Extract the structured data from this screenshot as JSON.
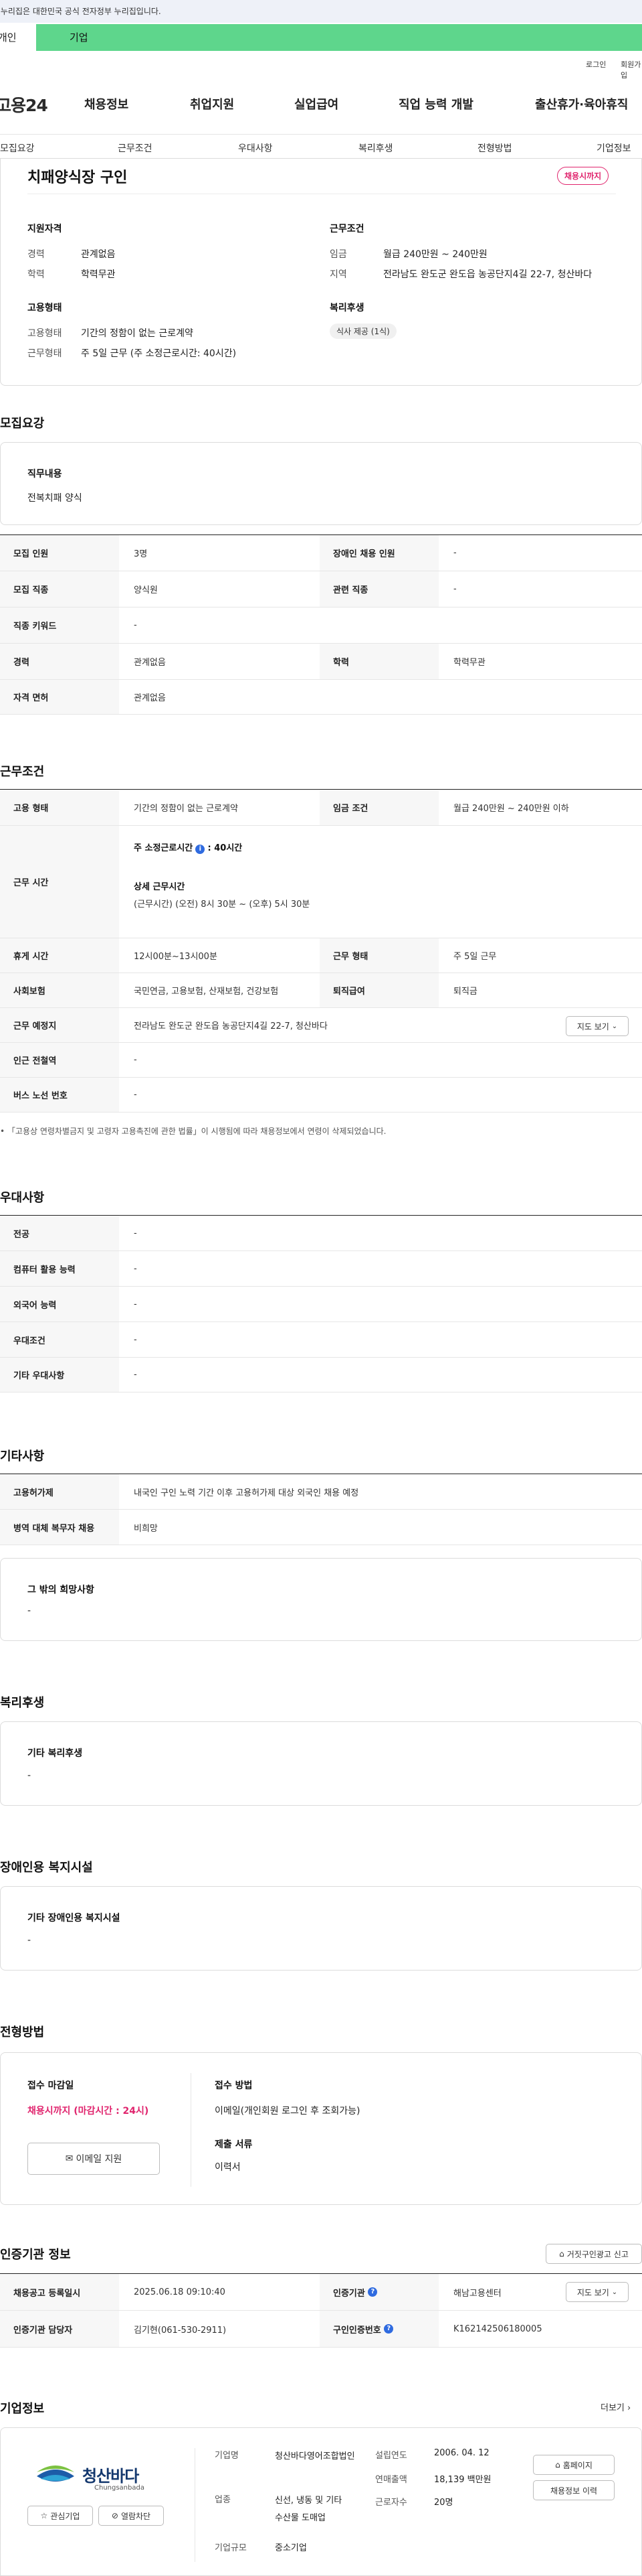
{
  "gov_bar": "이 누리집은 대한민국 공식 전자정부 누리집입니다.",
  "top_tabs": {
    "personal": "개인",
    "company": "기업"
  },
  "util": {
    "login": "로그인",
    "signup": "회원가입"
  },
  "logo": "고용24",
  "gnb": [
    "채용정보",
    "취업지원",
    "실업급여",
    "직업 능력 개발",
    "출산휴가·육아휴직"
  ],
  "subnav": [
    "모집요강",
    "근무조건",
    "우대사항",
    "복리후생",
    "전형방법",
    "기업정보"
  ],
  "summary": {
    "title": "치패양식장 구인",
    "status": "채용시까지",
    "qual_title": "지원자격",
    "career_label": "경력",
    "career_value": "관계없음",
    "edu_label": "학력",
    "edu_value": "학력무관",
    "emp_title": "고용형태",
    "emp_label": "고용형태",
    "emp_value": "기간의 정함이 없는 근로계약",
    "work_form_label": "근무형태",
    "work_form_value": "주 5일 근무 (주 소정근로시간: 40시간)",
    "cond_title": "근무조건",
    "wage_label": "임금",
    "wage_value": "월급 240만원 ~ 240만원",
    "region_label": "지역",
    "region_value": "전라남도 완도군 완도읍 농공단지4길 22-7, 청산바다",
    "welfare_title": "복리후생",
    "welfare_pill": "식사 제공 (1식)"
  },
  "recruit": {
    "heading": "모집요강",
    "duty_title": "직무내용",
    "duty_value": "전복치패 양식",
    "rows": [
      {
        "l1": "모집 인원",
        "v1": "3명",
        "l2": "장애인 채용 인원",
        "v2": "-"
      },
      {
        "l1": "모집 직종",
        "v1": "양식원",
        "l2": "관련 직종",
        "v2": "-"
      },
      {
        "l1": "직종 키워드",
        "v1": "-"
      },
      {
        "l1": "경력",
        "v1": "관계없음",
        "l2": "학력",
        "v2": "학력무관"
      },
      {
        "l1": "자격 면허",
        "v1": "관계없음"
      }
    ]
  },
  "workcond": {
    "heading": "근무조건",
    "emp_type_label": "고용 형태",
    "emp_type_value": "기간의 정함이 없는 근로계약",
    "wage_label": "임금 조건",
    "wage_value": "월급 240만원 ~ 240만원 이하",
    "hours_label": "근무 시간",
    "hours_week": "주 소정근로시간",
    "hours_week_value": ": 40시간",
    "hours_detail_title": "상세 근무시간",
    "hours_detail_value": "(근무시간) (오전) 8시 30분 ~ (오후) 5시 30분",
    "break_label": "휴게 시간",
    "break_value": "12시00분~13시00분",
    "form_label": "근무 형태",
    "form_value": "주 5일 근무",
    "insurance_label": "사회보험",
    "insurance_value": "국민연금, 고용보험, 산재보험, 건강보험",
    "severance_label": "퇴직급여",
    "severance_value": "퇴직금",
    "location_label": "근무 예정지",
    "location_value": "전라남도 완도군 완도읍 농공단지4길 22-7, 청산바다",
    "map_btn": "지도 보기",
    "subway_label": "인근 전철역",
    "subway_value": "-",
    "bus_label": "버스 노선 번호",
    "bus_value": "-",
    "note": "「고용상 연령차별금지 및 고령자 고용촉진에 관한 법률」이 시행됨에 따라 채용정보에서 연령이 삭제되었습니다."
  },
  "pref": {
    "heading": "우대사항",
    "rows": [
      {
        "l": "전공",
        "v": "-"
      },
      {
        "l": "컴퓨터 활용 능력",
        "v": "-"
      },
      {
        "l": "외국어 능력",
        "v": "-"
      },
      {
        "l": "우대조건",
        "v": "-"
      },
      {
        "l": "기타 우대사항",
        "v": "-"
      }
    ]
  },
  "etc": {
    "heading": "기타사항",
    "rows": [
      {
        "l": "고용허가제",
        "v": "내국인 구인 노력 기간 이후 고용허가제 대상 외국인 채용 예정"
      },
      {
        "l": "병역 대체 복무자 채용",
        "v": "비희망"
      }
    ],
    "wish_title": "그 밖의 희망사항",
    "wish_value": "-"
  },
  "welfare": {
    "heading": "복리후생",
    "card_title": "기타 복리후생",
    "card_value": "-"
  },
  "disabled": {
    "heading": "장애인용 복지시설",
    "card_title": "기타 장애인용 복지시설",
    "card_value": "-"
  },
  "selection": {
    "heading": "전형방법",
    "deadline_title": "접수 마감일",
    "deadline_value": "채용시까지 (마감시간 : 24시)",
    "email_btn": "이메일 지원",
    "method_title": "접수 방법",
    "method_value": "이메일(개인회원 로그인 후 조회가능)",
    "docs_title": "제출 서류",
    "docs_value": "이력서"
  },
  "cert": {
    "heading": "인증기관 정보",
    "report_btn": "거짓구인광고 신고",
    "reg_label": "채용공고 등록일시",
    "reg_value": "2025.06.18 09:10:40",
    "org_label": "인증기관",
    "org_value": "해남고용센터",
    "map_btn": "지도 보기",
    "mgr_label": "인증기관 담당자",
    "mgr_value": "김기현(061-530-2911)",
    "no_label": "구인인증번호",
    "no_value": "K162142506180005"
  },
  "company": {
    "heading": "기업정보",
    "more": "더보기",
    "logo_kr": "청산바다",
    "logo_en": "Chungsanbada",
    "fav_btn": "관심기업",
    "block_btn": "열람차단",
    "name_label": "기업명",
    "name_value": "청산바다영어조합법인",
    "ind_label": "업종",
    "ind_value": "신선, 냉동 및 기타 수산물 도매업",
    "size_label": "기업규모",
    "size_value": "중소기업",
    "est_label": "설립연도",
    "est_value": "2006. 04. 12",
    "sales_label": "연매출액",
    "sales_value": "18,139 백만원",
    "emp_label": "근로자수",
    "emp_value": "20명",
    "home_btn": "홈페이지",
    "hist_btn": "채용정보 이력"
  }
}
